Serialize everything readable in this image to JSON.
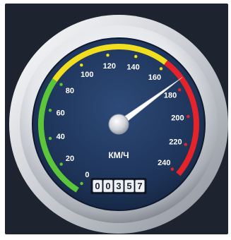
{
  "speedometer": {
    "unit": "КМ/Ч",
    "scale_min": 0,
    "scale_max": 240,
    "tick_labels": [
      "0",
      "20",
      "40",
      "60",
      "80",
      "100",
      "120",
      "140",
      "160",
      "180",
      "200",
      "220",
      "240"
    ],
    "needle_speed": 174,
    "odometer": [
      "0",
      "0",
      "3",
      "5",
      "7"
    ],
    "zones": [
      {
        "name": "green",
        "from": 0,
        "to": 80,
        "color": "#5cc63a"
      },
      {
        "name": "yellow",
        "from": 80,
        "to": 160,
        "color": "#f1df1f"
      },
      {
        "name": "red",
        "from": 160,
        "to": 240,
        "color": "#e5232a"
      }
    ],
    "colors": {
      "background": "#1d2430",
      "dial_face": "#1e3459",
      "needle": "#ffffff"
    }
  }
}
